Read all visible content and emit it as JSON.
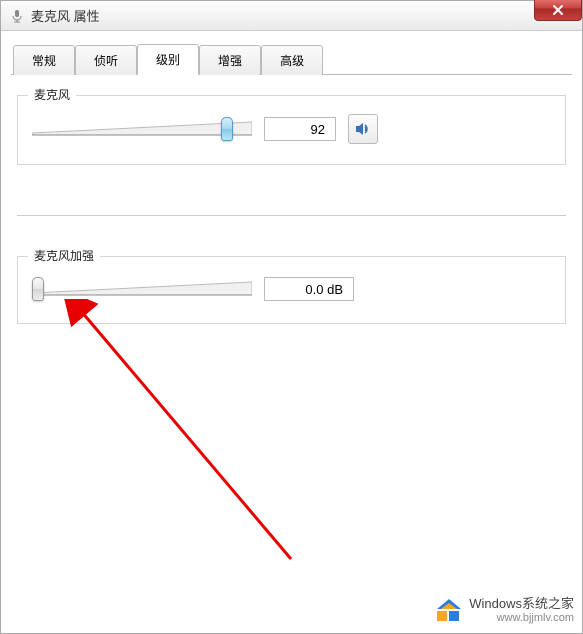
{
  "window": {
    "title": "麦克风 属性"
  },
  "tabs": {
    "items": [
      {
        "label": "常规"
      },
      {
        "label": "侦听"
      },
      {
        "label": "级别"
      },
      {
        "label": "增强"
      },
      {
        "label": "高级"
      }
    ],
    "active_index": 2
  },
  "sliders": {
    "mic": {
      "label": "麦克风",
      "value": "92",
      "position_percent": 86
    },
    "boost": {
      "label": "麦克风加强",
      "value": "0.0 dB",
      "position_percent": 0
    }
  },
  "watermark": {
    "brand": "Windows系统之家",
    "url": "www.bjjmlv.com"
  }
}
